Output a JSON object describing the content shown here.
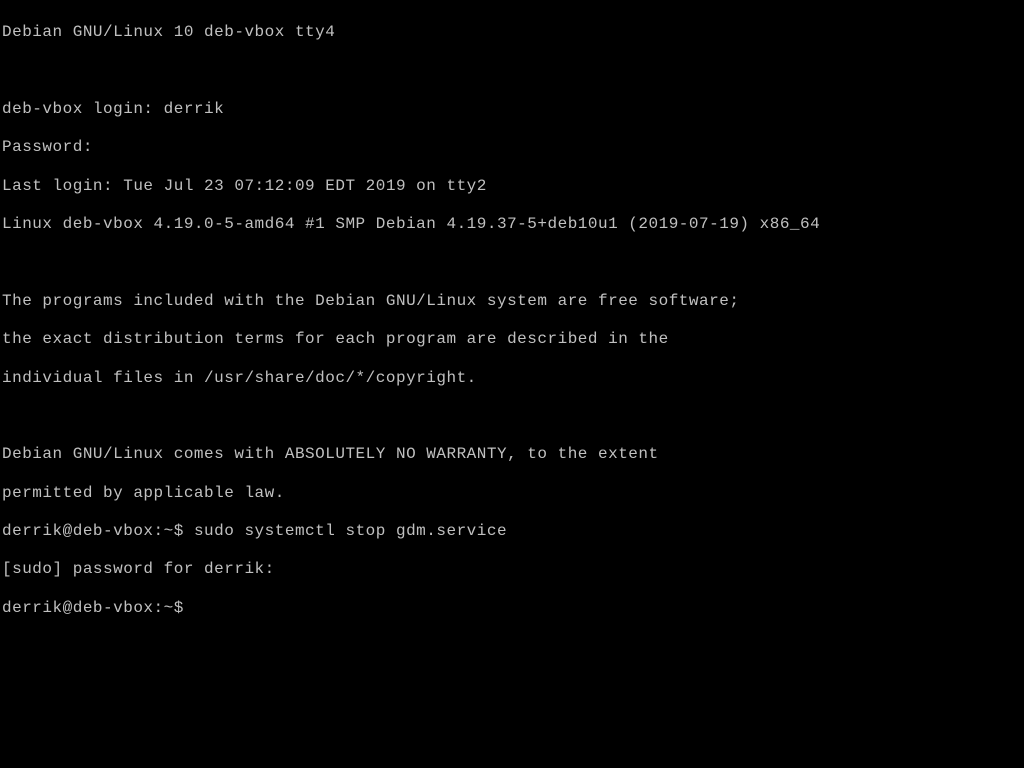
{
  "terminal": {
    "banner": "Debian GNU/Linux 10 deb-vbox tty4",
    "login_prompt": "deb-vbox login: ",
    "username": "derrik",
    "password_prompt": "Password:",
    "last_login": "Last login: Tue Jul 23 07:12:09 EDT 2019 on tty2",
    "kernel_info": "Linux deb-vbox 4.19.0-5-amd64 #1 SMP Debian 4.19.37-5+deb10u1 (2019-07-19) x86_64",
    "motd_line1": "The programs included with the Debian GNU/Linux system are free software;",
    "motd_line2": "the exact distribution terms for each program are described in the",
    "motd_line3": "individual files in /usr/share/doc/*/copyright.",
    "motd_line4": "Debian GNU/Linux comes with ABSOLUTELY NO WARRANTY, to the extent",
    "motd_line5": "permitted by applicable law.",
    "prompt1": "derrik@deb-vbox:~$ ",
    "command1": "sudo systemctl stop gdm.service",
    "sudo_prompt": "[sudo] password for derrik:",
    "prompt2": "derrik@deb-vbox:~$ "
  }
}
